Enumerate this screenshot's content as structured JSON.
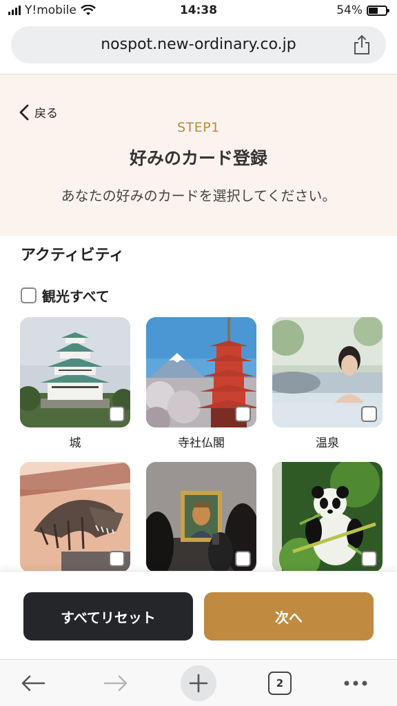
{
  "status_bar": {
    "carrier": "Y!mobile",
    "time": "14:38",
    "battery": "54%",
    "battery_level": 0.54
  },
  "browser": {
    "url": "nospot.new-ordinary.co.jp",
    "tab_count": "2"
  },
  "header": {
    "back_label": "戻る",
    "step": "STEP1",
    "title": "好みのカード登録",
    "description": "あなたの好みのカードを選択してください。"
  },
  "section": {
    "title": "アクティビティ",
    "select_all_label": "観光すべて",
    "cards": [
      {
        "label": "城",
        "checked": false
      },
      {
        "label": "寺社仏閣",
        "checked": false
      },
      {
        "label": "温泉",
        "checked": false
      },
      {
        "label": "",
        "checked": false
      },
      {
        "label": "",
        "checked": false
      },
      {
        "label": "",
        "checked": false
      }
    ]
  },
  "actions": {
    "reset_label": "すべてリセット",
    "next_label": "次へ"
  },
  "colors": {
    "header_bg": "#fdf3ee",
    "accent": "#c08a40",
    "step": "#b98a3c",
    "dark_button": "#25262a"
  }
}
